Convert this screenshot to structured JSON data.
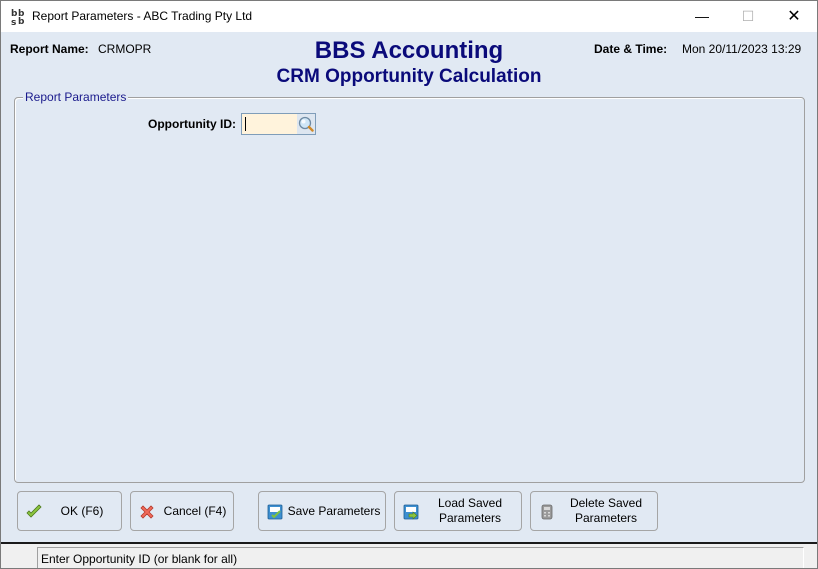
{
  "window": {
    "title": "Report Parameters - ABC Trading Pty Ltd",
    "icon": "bbs-app-icon",
    "controls": {
      "minimize": "—",
      "maximize": "☐",
      "close": "✕"
    }
  },
  "header": {
    "report_name_label": "Report Name:",
    "report_name_value": "CRMOPR",
    "app_title": "BBS Accounting",
    "report_title": "CRM Opportunity Calculation",
    "datetime_label": "Date & Time:",
    "datetime_value": "Mon 20/11/2023 13:29"
  },
  "parameters": {
    "group_label": "Report Parameters",
    "fields": [
      {
        "label": "Opportunity ID:",
        "value": "",
        "placeholder": "",
        "lookup_icon": "magnifier-icon"
      }
    ]
  },
  "buttons": [
    {
      "label": "OK (F6)",
      "icon": "check-icon"
    },
    {
      "label": "Cancel (F4)",
      "icon": "cancel-x-icon"
    },
    {
      "label": "Save Parameters",
      "icon": "save-params-icon"
    },
    {
      "label": "Load Saved\nParameters",
      "icon": "load-params-icon"
    },
    {
      "label": "Delete Saved\nParameters",
      "icon": "delete-params-icon"
    }
  ],
  "status": {
    "message": "Enter Opportunity ID (or blank for all)"
  },
  "colors": {
    "title_blue": "#0a0a7a",
    "background": "#e1e9f3",
    "input_bg": "#fff3dc"
  }
}
